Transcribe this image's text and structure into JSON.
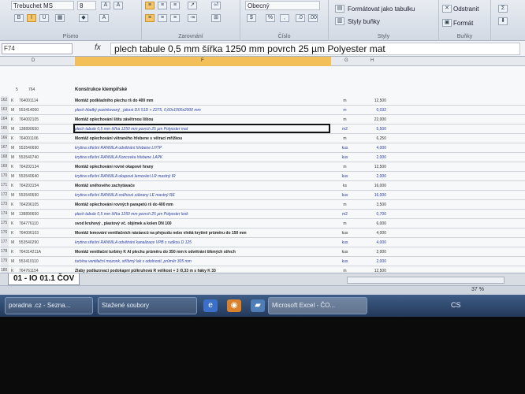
{
  "ribbon": {
    "font_name": "Trebuchet MS",
    "font_size": "8",
    "number_format": "Obecný",
    "groups": {
      "font": "Písmo",
      "alignment": "Zarovnání",
      "number": "Číslo",
      "styles": "Styly",
      "cells": "Buňky"
    },
    "format_as_table": "Formátovat jako tabulku",
    "cell_styles": "Styly buňky",
    "delete": "Odstranit",
    "format": "Formát",
    "bold": "B",
    "italic": "I",
    "underline": "U"
  },
  "formula_bar": {
    "name_box": "F74",
    "fx": "fx",
    "content": "plech tabule 0,5 mm šířka 1250 mm povrch 25 µm Polyester mat"
  },
  "columns": {
    "d": "D",
    "f": "F",
    "g": "G",
    "h": "H"
  },
  "section": {
    "row": "5",
    "code": "764",
    "title": "Konstrukce klempířské"
  },
  "rows": [
    {
      "rn": "162",
      "k": "K",
      "code": "764001114",
      "desc": "Montáž podkladního plechu rš do 400 mm",
      "unit": "m",
      "qty": "12,500",
      "blue": false
    },
    {
      "rn": "163",
      "k": "M",
      "code": "553414000",
      "desc": "plech hladký pozinkovaný , jakost DX 51D + Z275, 0,60x1000x2000 mm",
      "unit": "m",
      "qty": "0,032",
      "blue": true
    },
    {
      "rn": "164",
      "k": "K",
      "code": "764002105",
      "desc": "Montáž oplechování štítu závětrnou lištou",
      "unit": "m",
      "qty": "22,000",
      "blue": false
    },
    {
      "rn": "165",
      "k": "M",
      "code": "138890650",
      "desc": "plech tabule 0,5 mm šířka 1250 mm povrch 25 µm Polyester mat",
      "unit": "m2",
      "qty": "5,500",
      "blue": true
    },
    {
      "rn": "166",
      "k": "K",
      "code": "764001106",
      "desc": "Montáž oplechování větraného hřebene s větrací mřížkou",
      "unit": "m",
      "qty": "6,250",
      "blue": false
    },
    {
      "rn": "167",
      "k": "M",
      "code": "553540690",
      "desc": "krytina střešní RANNILA odvětrání hřebene LHTP",
      "unit": "kus",
      "qty": "4,000",
      "blue": true
    },
    {
      "rn": "168",
      "k": "M",
      "code": "553540740",
      "desc": "krytina střešní RANNILA Koncovka hřebene LAPK",
      "unit": "kus",
      "qty": "2,000",
      "blue": true
    },
    {
      "rn": "169",
      "k": "K",
      "code": "764202134",
      "desc": "Montáž oplechování rovné okapové hrany",
      "unit": "m",
      "qty": "12,500",
      "blue": false
    },
    {
      "rn": "170",
      "k": "M",
      "code": "553540640",
      "desc": "krytina střešní RANNILA okapové lemování LR mastný IR",
      "unit": "kus",
      "qty": "2,000",
      "blue": true
    },
    {
      "rn": "171",
      "k": "K",
      "code": "764203154",
      "desc": "Montáž sněhového zachytávače",
      "unit": "ks",
      "qty": "16,000",
      "blue": false
    },
    {
      "rn": "172",
      "k": "M",
      "code": "553540690",
      "desc": "krytina střešní RANNILA sněhové zábrany LE mastný RE",
      "unit": "kus",
      "qty": "16,000",
      "blue": true
    },
    {
      "rn": "173",
      "k": "K",
      "code": "764206105",
      "desc": "Montáž oplechování rovných parapetů rš do 400 mm",
      "unit": "m",
      "qty": "3,500",
      "blue": false
    },
    {
      "rn": "174",
      "k": "M",
      "code": "138890650",
      "desc": "plech tabule 0,5 mm šířka 1250 mm povrch 25 µm Polyester lesk",
      "unit": "m2",
      "qty": "0,700",
      "blue": true
    },
    {
      "rn": "175",
      "k": "K",
      "code": "764776110",
      "desc": "svod kruhový , plastový vč. objímek a kolen DN 100",
      "unit": "m",
      "qty": "6,000",
      "blue": false
    },
    {
      "rn": "176",
      "k": "K",
      "code": "764006103",
      "desc": "Montáž lemování ventilačních nástavců na přejezdu nebo vlnitá krytině průměru do 150 mm",
      "unit": "kus",
      "qty": "4,000",
      "blue": false
    },
    {
      "rn": "177",
      "k": "M",
      "code": "553540290",
      "desc": "krytina střešní RANNILA odvětrání kanalizace VPB s rudkou D 125",
      "unit": "kus",
      "qty": "4,000",
      "blue": true
    },
    {
      "rn": "178",
      "k": "K",
      "code": "764314211A",
      "desc": "Montáž ventilační turbíny K AI plechu průměru do 350 mm k odvětrání šikmých střech",
      "unit": "kus",
      "qty": "2,000",
      "blue": false
    },
    {
      "rn": "179",
      "k": "M",
      "code": "553410110",
      "desc": "turbína ventilační mozonk, stříbrný lak s odolností, průměr 305 mm",
      "unit": "kus",
      "qty": "2,000",
      "blue": true
    },
    {
      "rn": "180",
      "k": "K",
      "code": "764761154",
      "desc": "Žlaby podlazovací podokapní půlkruhová R velikost + 3 /0,33 m s háky K 33",
      "unit": "m",
      "qty": "12,500",
      "blue": false
    }
  ],
  "sheet_tab": "01 - IO 01.1 ČOV",
  "zoom": "37 %",
  "taskbar": {
    "items": [
      "poradna .cz - Sezna...",
      "Stažené soubory",
      "Microsoft Excel - ČO..."
    ],
    "lang": "CS"
  }
}
